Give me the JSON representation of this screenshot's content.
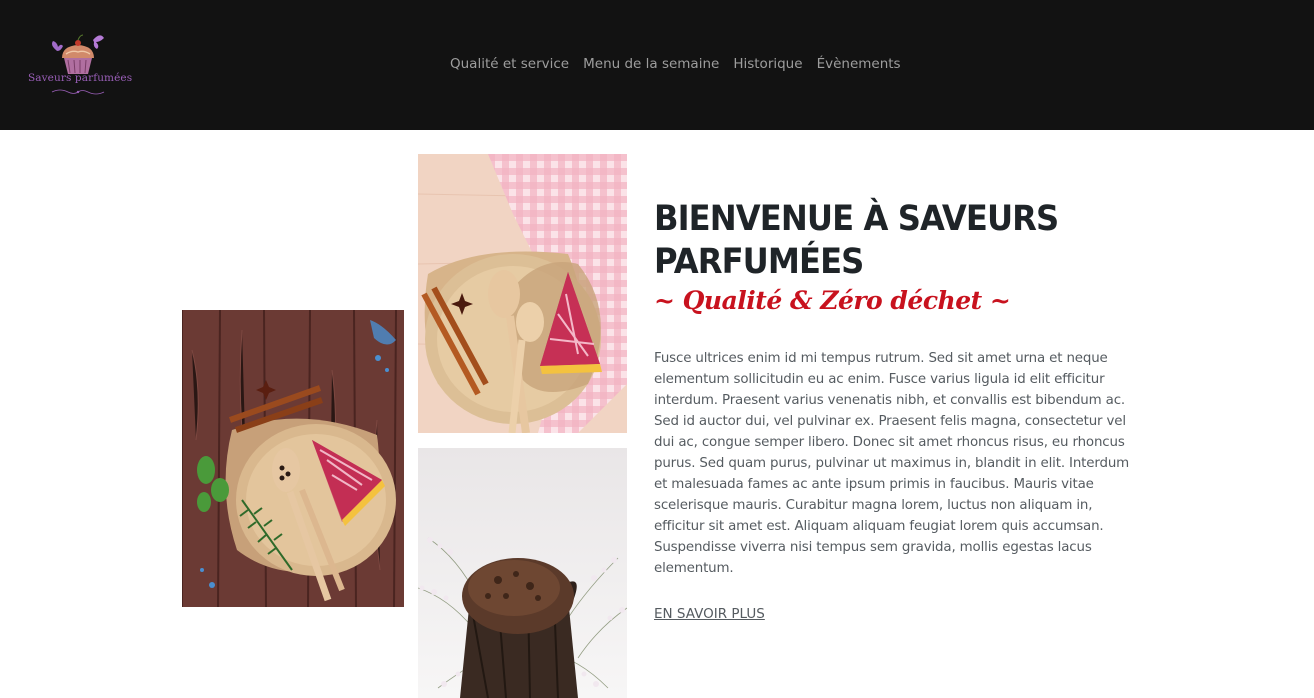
{
  "header": {
    "logo": {
      "icon": "cupcake-butterfly-logo",
      "text": "Saveurs parfumées"
    },
    "nav": [
      {
        "label": "Qualité et service"
      },
      {
        "label": "Menu de la semaine"
      },
      {
        "label": "Historique"
      },
      {
        "label": "Évènements"
      }
    ]
  },
  "gallery": [
    {
      "name": "cheesecake-on-wooden-table-photo"
    },
    {
      "name": "cheesecake-on-gingham-cloth-photo"
    },
    {
      "name": "chocolate-muffin-with-flowers-photo"
    }
  ],
  "intro": {
    "title": "BIENVENUE À SAVEURS PARFUMÉES",
    "tagline": "~ Qualité & Zéro déchet ~",
    "body": "Fusce ultrices enim id mi tempus rutrum. Sed sit amet urna et neque elementum sollicitudin eu ac enim. Fusce varius ligula id elit efficitur interdum. Praesent varius venenatis nibh, et convallis est bibendum ac. Sed id auctor dui, vel pulvinar ex. Praesent felis magna, consectetur vel dui ac, congue semper libero. Donec sit amet rhoncus risus, eu rhoncus purus. Sed quam purus, pulvinar ut maximus in, blandit in elit. Interdum et malesuada fames ac ante ipsum primis in faucibus. Mauris vitae scelerisque mauris. Curabitur magna lorem, luctus non aliquam in, efficitur sit amet est. Aliquam aliquam feugiat lorem quis accumsan. Suspendisse viverra nisi tempus sem gravida, mollis egestas lacus elementum.",
    "link_label": "EN SAVOIR PLUS"
  },
  "colors": {
    "header_bg": "#121212",
    "nav_text": "#9d9d9d",
    "title": "#1f2428",
    "tagline": "#c8121e",
    "body_text": "#555b60",
    "logo_purple": "#9a5fb8"
  }
}
